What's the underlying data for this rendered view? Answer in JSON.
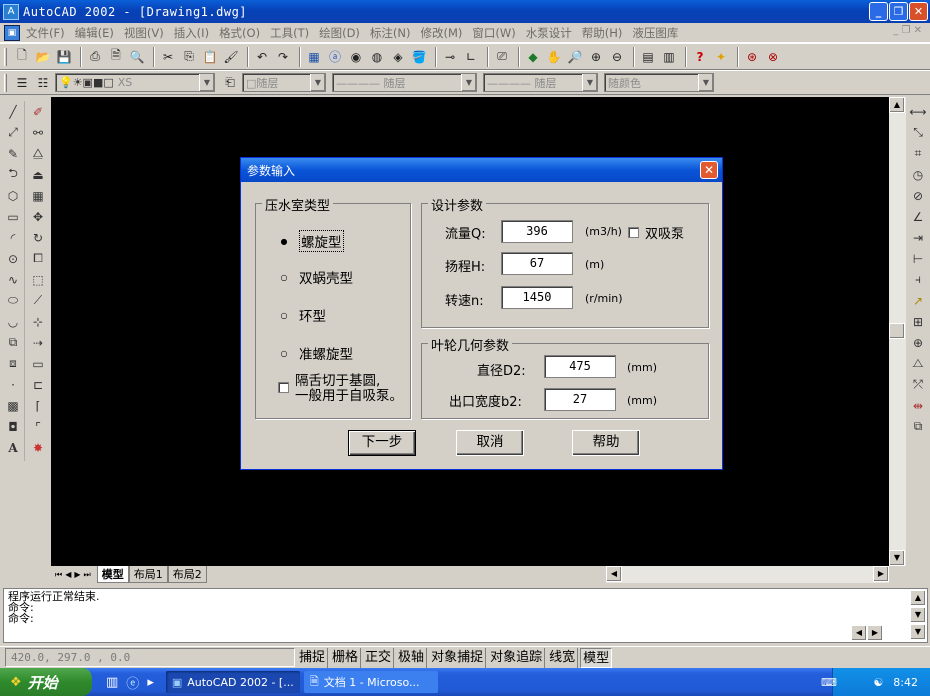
{
  "window": {
    "title": "AutoCAD 2002 - [Drawing1.dwg]",
    "app_icon": "autocad-app-icon",
    "minimize": "_",
    "restore": "❐",
    "close": "✕"
  },
  "menu": {
    "items": [
      "文件(F)",
      "编辑(E)",
      "视图(V)",
      "插入(I)",
      "格式(O)",
      "工具(T)",
      "绘图(D)",
      "标注(N)",
      "修改(M)",
      "窗口(W)",
      "水泵设计",
      "帮助(H)",
      "液压图库"
    ]
  },
  "toolbar_props": {
    "layer_value": "XS",
    "color_value": "□随层",
    "linetype_value": "———— 随层",
    "lineweight_value": "———— 随层",
    "plotstyle_value": "随颜色"
  },
  "drawing": {
    "tabs": [
      "模型",
      "布局1",
      "布局2"
    ],
    "active_tab": "模型"
  },
  "dialog": {
    "title": "参数输入",
    "close": "✕",
    "volute_group": {
      "legend": "压水室类型",
      "options": [
        "螺旋型",
        "双蜗壳型",
        "环型",
        "准螺旋型"
      ],
      "selected": "螺旋型",
      "checkbox_label_line1": "隔舌切于基圆,",
      "checkbox_label_line2": "一般用于自吸泵。",
      "checkbox_checked": false
    },
    "design_group": {
      "legend": "设计参数",
      "flow_label": "流量Q:",
      "flow_value": "396",
      "flow_unit": "(m3/h)",
      "double_suction_label": "双吸泵",
      "double_suction_checked": false,
      "head_label": "扬程H:",
      "head_value": "67",
      "head_unit": "(m)",
      "speed_label": "转速n:",
      "speed_value": "1450",
      "speed_unit": "(r/min)"
    },
    "impeller_group": {
      "legend": "叶轮几何参数",
      "diameter_label": "直径D2:",
      "diameter_value": "475",
      "diameter_unit": "(mm)",
      "width_label": "出口宽度b2:",
      "width_value": "27",
      "width_unit": "(mm)"
    },
    "buttons": {
      "next": "下一步",
      "cancel": "取消",
      "help": "帮助"
    }
  },
  "command": {
    "lines": [
      "程序运行正常结束.",
      "命令:",
      "命令:"
    ]
  },
  "status": {
    "coords": "420.0, 297.0 , 0.0",
    "toggles": [
      "捕捉",
      "栅格",
      "正交",
      "极轴",
      "对象捕捉",
      "对象追踪",
      "线宽",
      "模型"
    ],
    "active_toggle": "模型"
  },
  "taskbar": {
    "start": "开始",
    "tasks": [
      "AutoCAD 2002 - [...",
      "文档 1 - Microso..."
    ],
    "clock": "8:42"
  },
  "colors": {
    "title_blue": "#0a4fc8",
    "canvas": "#000000",
    "dialog_face": "#d4d0c8",
    "close_red": "#e25a30",
    "start_green": "#2f8a2c"
  }
}
